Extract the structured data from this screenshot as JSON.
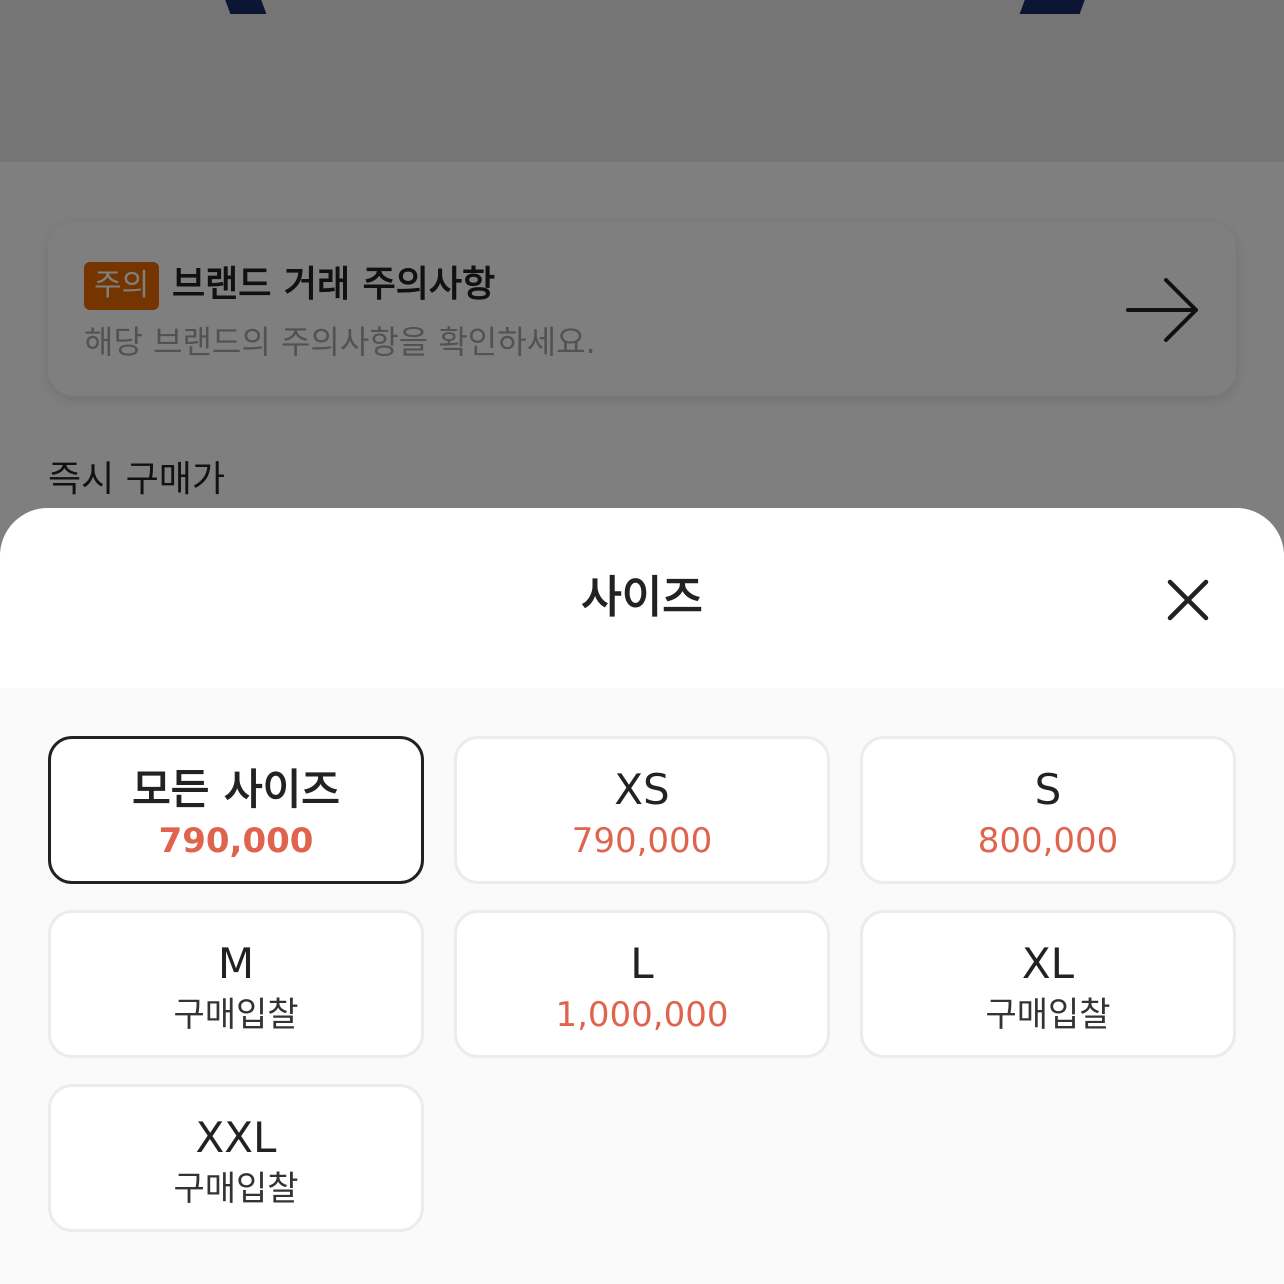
{
  "background": {
    "notice": {
      "badge": "주의",
      "title": "브랜드 거래 주의사항",
      "subtitle": "해당 브랜드의 주의사항을 확인하세요."
    },
    "instant_price_label": "즉시 구매가"
  },
  "sheet": {
    "title": "사이즈",
    "sizes": [
      {
        "name": "모든 사이즈",
        "price": "790,000",
        "selected": true
      },
      {
        "name": "XS",
        "price": "790,000"
      },
      {
        "name": "S",
        "price": "800,000"
      },
      {
        "name": "M",
        "price": "구매입찰"
      },
      {
        "name": "L",
        "price": "1,000,000"
      },
      {
        "name": "XL",
        "price": "구매입찰"
      },
      {
        "name": "XXL",
        "price": "구매입찰"
      }
    ]
  },
  "colors": {
    "price_accent": "#e0644d",
    "notice_badge": "#e86b00",
    "selected_border": "#222222"
  }
}
